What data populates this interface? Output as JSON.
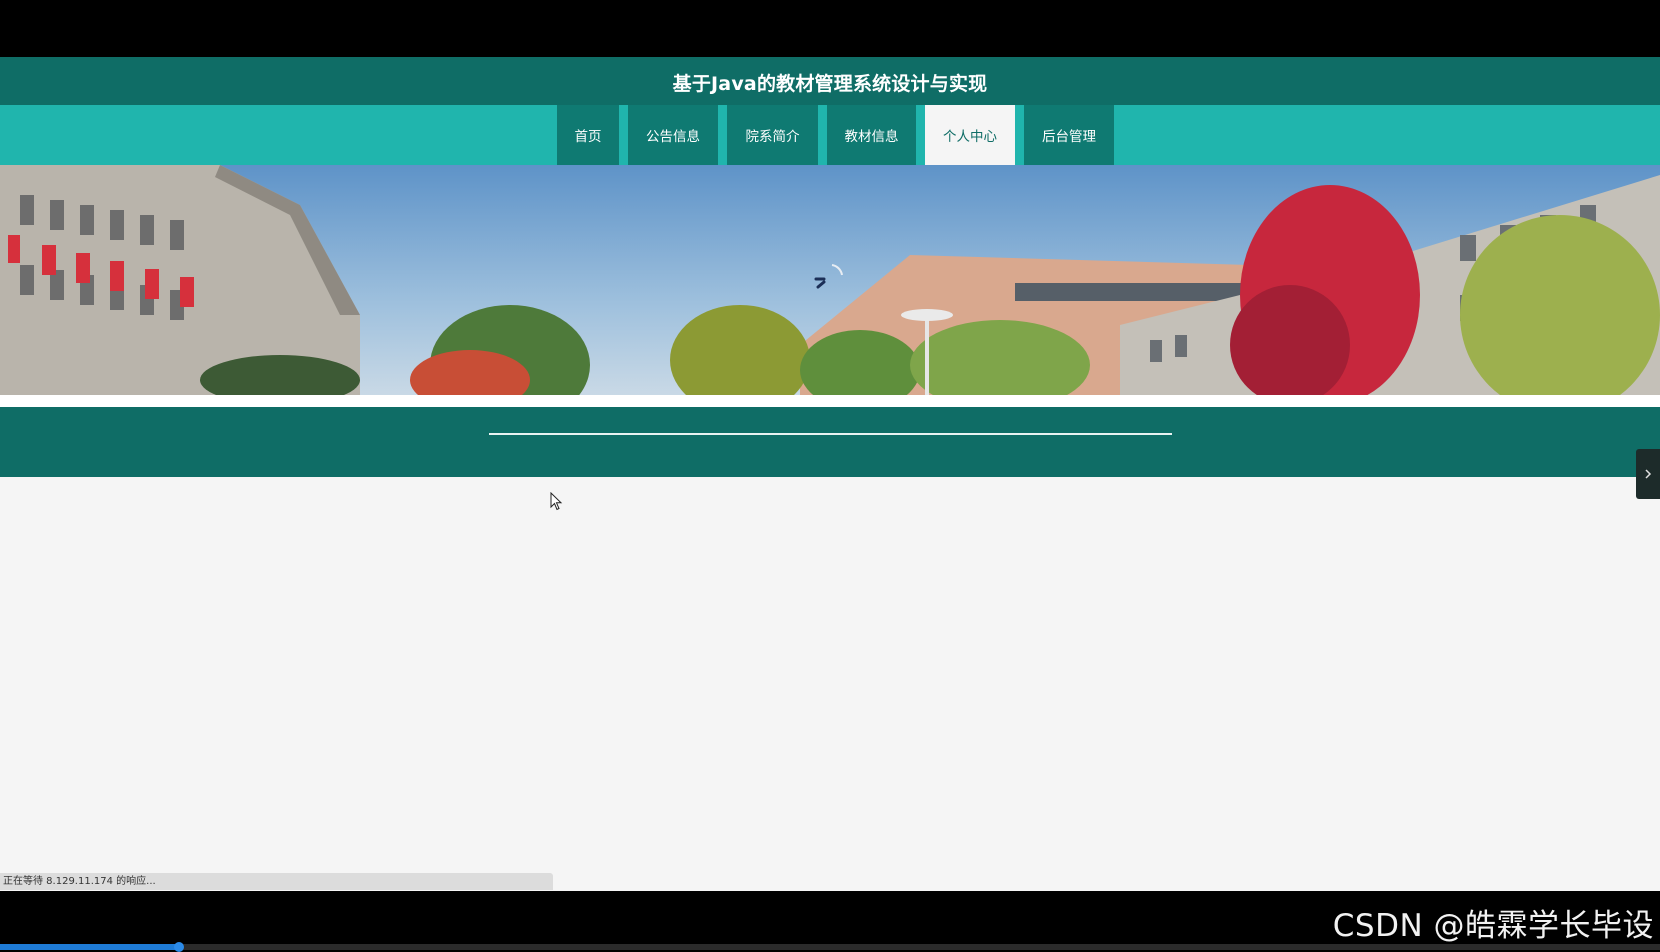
{
  "site": {
    "title": "基于Java的教材管理系统设计与实现"
  },
  "nav": {
    "items": [
      {
        "label": "首页"
      },
      {
        "label": "公告信息"
      },
      {
        "label": "院系简介"
      },
      {
        "label": "教材信息"
      },
      {
        "label": "个人中心"
      },
      {
        "label": "后台管理"
      }
    ],
    "active_label": "个人中心"
  },
  "banner": {
    "icon": "loading-spinner-icon"
  },
  "side_toggle": {
    "icon": "chevron-right-icon"
  },
  "browser": {
    "status_text": "正在等待 8.129.11.174 的响应..."
  },
  "video_player": {
    "progress": 0.108
  },
  "watermark": {
    "text": "CSDN @皓霖学长毕设"
  },
  "colors": {
    "header": "#0f6d66",
    "navbar": "#20b5ad",
    "nav_item": "#0f7a72",
    "active_nav": "#f5f5f5"
  }
}
